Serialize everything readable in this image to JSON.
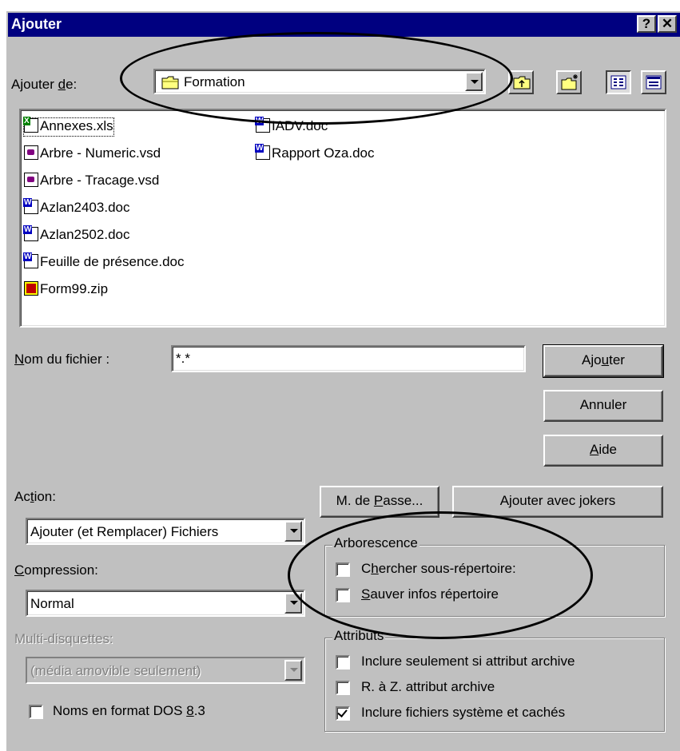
{
  "window": {
    "title": "Ajouter",
    "help_glyph": "?",
    "close_glyph": "✕"
  },
  "lookin": {
    "label_pre": "Ajouter ",
    "label_key": "d",
    "label_post": "e:",
    "value": "Formation"
  },
  "files": [
    {
      "name": "Annexes.xls",
      "icon": "excel-file-icon"
    },
    {
      "name": "Arbre - Numeric.vsd",
      "icon": "visio-file-icon"
    },
    {
      "name": "Arbre - Tracage.vsd",
      "icon": "visio-file-icon"
    },
    {
      "name": "Azlan2403.doc",
      "icon": "word-file-icon"
    },
    {
      "name": "Azlan2502.doc",
      "icon": "word-file-icon"
    },
    {
      "name": "Feuille de présence.doc",
      "icon": "word-file-icon"
    },
    {
      "name": "Form99.zip",
      "icon": "zip-file-icon"
    },
    {
      "name": "IADV.doc",
      "icon": "word-file-icon"
    },
    {
      "name": "Rapport Oza.doc",
      "icon": "word-file-icon"
    }
  ],
  "filename": {
    "label_key": "N",
    "label_rest": "om du fichier :",
    "value": "*.*"
  },
  "buttons": {
    "add_pre": "Ajo",
    "add_key": "u",
    "add_post": "ter",
    "cancel": "Annuler",
    "help_key": "A",
    "help_rest": "ide",
    "password_pre": "M. de ",
    "password_key": "P",
    "password_post": "asse...",
    "wildcards": "Ajouter avec jokers"
  },
  "action": {
    "label_pre": "Ac",
    "label_key": "t",
    "label_post": "ion:",
    "value": "Ajouter (et Remplacer) Fichiers"
  },
  "compression": {
    "label_key": "C",
    "label_rest": "ompression:",
    "value": "Normal"
  },
  "multidisk": {
    "label": "Multi-disquettes:",
    "value": "(média amovible seulement)"
  },
  "dos_names": {
    "label_pre": "Noms en format DOS ",
    "label_key": "8",
    "label_post": ".3",
    "checked": false
  },
  "tree_group": {
    "title": "Arborescence",
    "search_sub": {
      "label_pre": "C",
      "label_key": "h",
      "label_post": "ercher sous-répertoire:",
      "checked": false
    },
    "save_info": {
      "label_key": "S",
      "label_rest": "auver infos répertoire",
      "checked": false
    }
  },
  "attr_group": {
    "title": "Attributs",
    "only_archive": {
      "label": "Inclure seulement si attribut archive",
      "checked": false
    },
    "reset_archive": {
      "label": "R. à Z. attribut archive",
      "checked": false
    },
    "include_system": {
      "label": "Inclure fichiers système et cachés",
      "checked": true
    }
  }
}
